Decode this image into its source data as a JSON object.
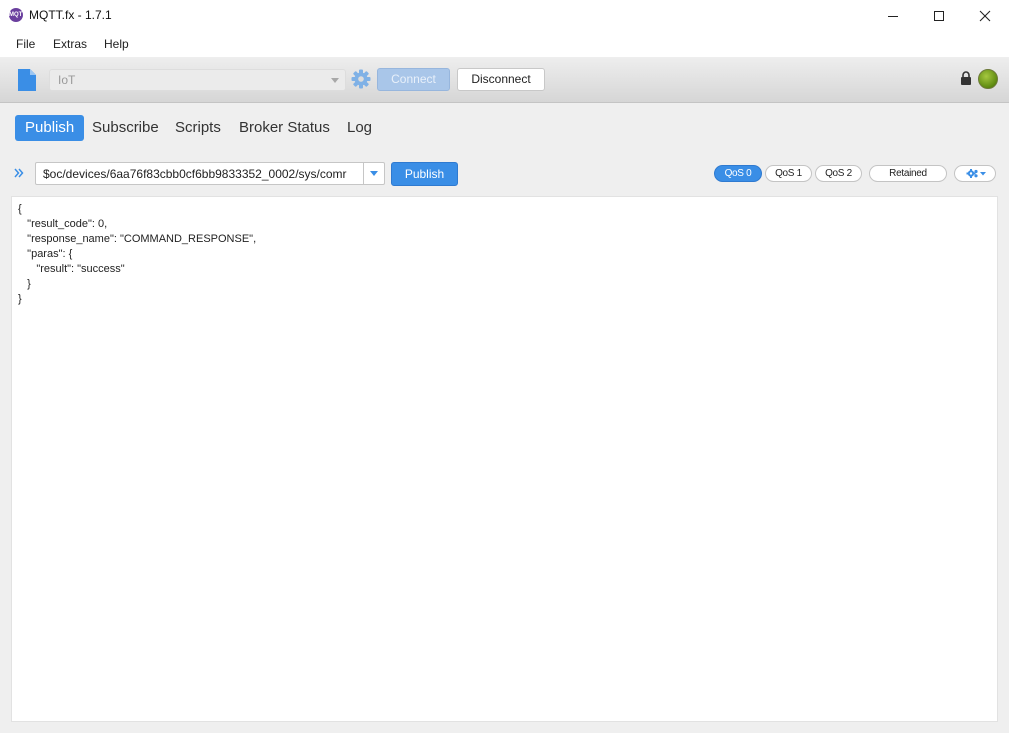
{
  "window": {
    "title": "MQTT.fx - 1.7.1",
    "app_icon_text": "MQTT"
  },
  "menu": {
    "items": [
      "File",
      "Extras",
      "Help"
    ]
  },
  "connection": {
    "profile_value": "IoT",
    "connect_label": "Connect",
    "disconnect_label": "Disconnect",
    "status_color": "#7aa81e"
  },
  "tabs": [
    {
      "label": "Publish",
      "active": true
    },
    {
      "label": "Subscribe",
      "active": false
    },
    {
      "label": "Scripts",
      "active": false
    },
    {
      "label": "Broker Status",
      "active": false
    },
    {
      "label": "Log",
      "active": false
    }
  ],
  "publish": {
    "topic_value": "$oc/devices/6aa76f83cbb0cf6bb9833352_0002/sys/comr",
    "publish_label": "Publish",
    "qos": [
      {
        "label": "QoS 0",
        "active": true
      },
      {
        "label": "QoS 1",
        "active": false
      },
      {
        "label": "QoS 2",
        "active": false
      }
    ],
    "retained_label": "Retained"
  },
  "payload": {
    "text": "{\n   \"result_code\": 0,\n   \"response_name\": \"COMMAND_RESPONSE\",\n   \"paras\": {\n      \"result\": \"success\"\n   }\n}"
  },
  "colors": {
    "accent": "#3a8ee6",
    "connect_disabled": "#a9c6e9"
  }
}
